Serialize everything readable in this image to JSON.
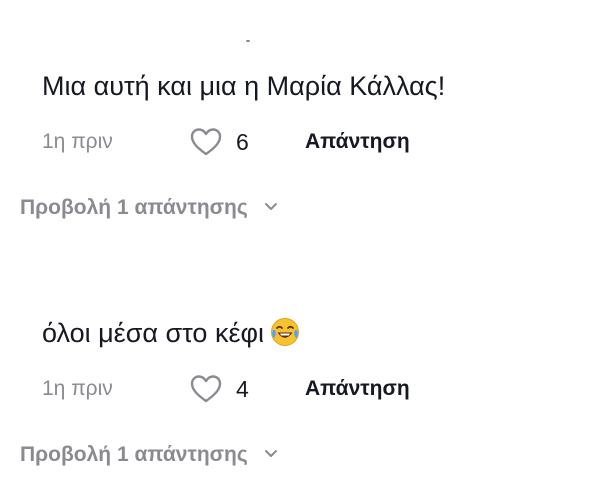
{
  "comments": [
    {
      "text": "Μια αυτή και μια η Μαρία Κάλλας!",
      "timestamp": "1η πριν",
      "likes": "6",
      "reply_label": "Απάντηση",
      "view_replies_label": "Προβολή 1 απάντησης",
      "emoji": ""
    },
    {
      "text": "όλοι μέσα στο κέφι",
      "timestamp": "1η πριν",
      "likes": "4",
      "reply_label": "Απάντηση",
      "view_replies_label": "Προβολή 1 απάντησης",
      "emoji": "face-with-tears-of-joy"
    }
  ],
  "colors": {
    "primary_text": "#161823",
    "secondary_text": "#8a8b91",
    "background": "#ffffff"
  },
  "icons": {
    "like": "heart-outline-icon",
    "expand": "chevron-down-icon"
  }
}
